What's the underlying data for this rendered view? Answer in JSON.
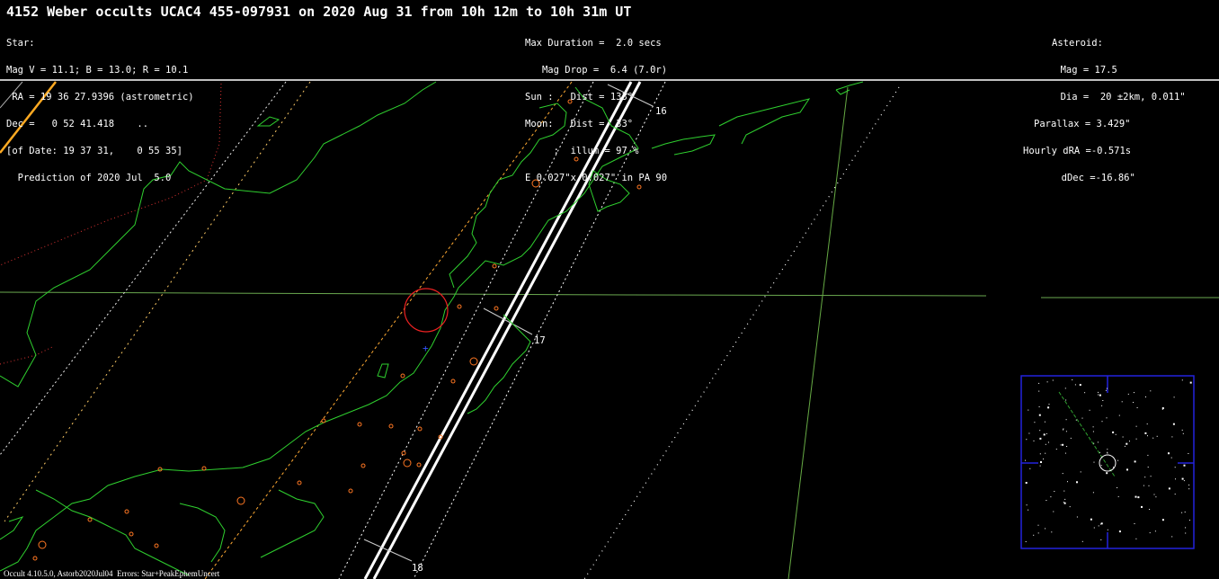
{
  "title": "4152 Weber occults UCAC4 455-097931 on 2020 Aug 31 from 10h 12m to 10h 31m UT",
  "star_block": [
    "Star:",
    "Mag V = 11.1; B = 13.0; R = 10.1",
    " RA = 19 36 27.9396 (astrometric)",
    "Dec =   0 52 41.418    ..",
    "[of Date: 19 37 31,    0 55 35]",
    "  Prediction of 2020 Jul  5.0"
  ],
  "event_block": [
    "Max Duration =  2.0 secs",
    "   Mag Drop =  6.4 (7.0r)",
    "Sun :   Dist = 133°",
    "Moon:   Dist =  33°",
    "     :  illum = 97 %",
    "E 0.027\"x 0.027\" in PA 90"
  ],
  "asteroid_block": [
    "Asteroid:",
    "     Mag = 17.5",
    "     Dia =  20 ±2km, 0.011\"",
    "Parallax = 3.429\"",
    "Hourly dRA =-0.571s",
    "  dDec =-16.86\""
  ],
  "time_ticks": [
    "16",
    "17",
    "18"
  ],
  "footer": "Occult 4.10.5.0, Astorb2020Jul04  Errors: Star+PeakEphemUncert",
  "colors": {
    "background": "#000000",
    "coastline": "#22cc22",
    "path": "#ffffff",
    "path_sigma": "#ffffff",
    "cities": "#ff6600",
    "border": "#cc2222",
    "meridian": "#66aa44",
    "inset_frame": "#1f1fd0"
  }
}
